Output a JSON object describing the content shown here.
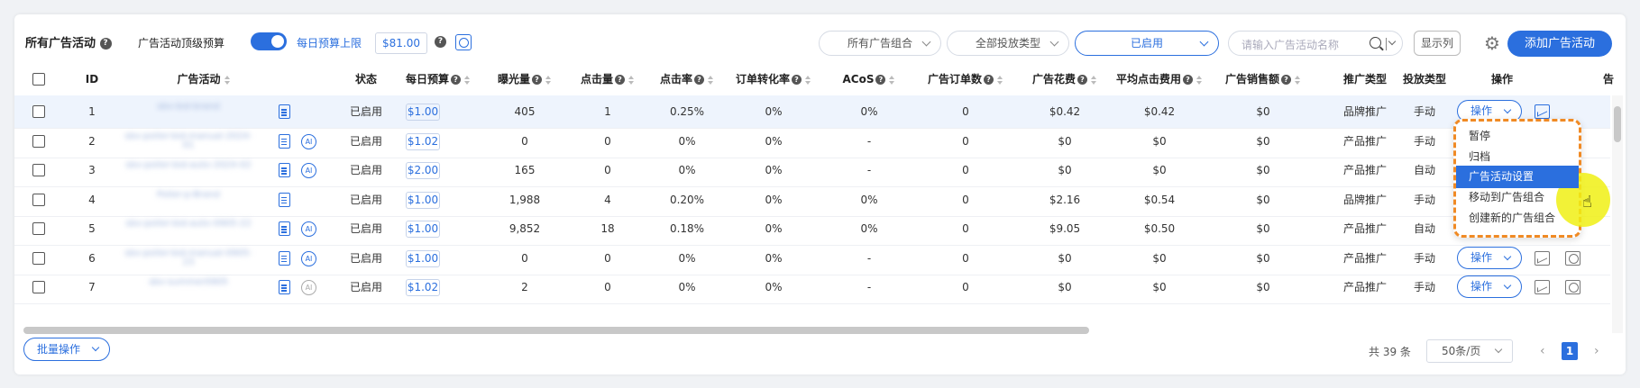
{
  "toolbar": {
    "title": "所有广告活动",
    "budget_label": "广告活动顶级预算",
    "daily_cap_label": "每日预算上限",
    "daily_cap_value": "$81.00",
    "filters": [
      "所有广告组合",
      "全部投放类型",
      "已启用"
    ],
    "search_placeholder": "请输入广告活动名称",
    "columns_button": "显示列",
    "add_button": "添加广告活动"
  },
  "table": {
    "headers": {
      "id": "ID",
      "campaign": "广告活动",
      "status": "状态",
      "daily_budget": "每日预算",
      "impressions": "曝光量",
      "clicks": "点击量",
      "ctr": "点击率",
      "cvr": "订单转化率",
      "acos": "ACoS",
      "orders": "广告订单数",
      "spend": "广告花费",
      "cpc": "平均点击费用",
      "sales": "广告销售额",
      "promo_type": "推广类型",
      "targeting": "投放类型",
      "actions": "操作",
      "extra": "告"
    },
    "rows": [
      {
        "id": "1",
        "name": "sbv-bid-brand",
        "status": "已启用",
        "budget": "$1.00",
        "impressions": "405",
        "clicks": "1",
        "ctr": "0.25%",
        "cvr": "0%",
        "acos": "0%",
        "orders": "0",
        "spend": "$0.42",
        "cpc": "$0.42",
        "sales": "$0",
        "promo": "品牌推广",
        "targeting": "手动",
        "ai": false,
        "ai_grey": false
      },
      {
        "id": "2",
        "name": "sbv-poller-bid-manual-2024-01",
        "status": "已启用",
        "budget": "$1.02",
        "impressions": "0",
        "clicks": "0",
        "ctr": "0%",
        "cvr": "0%",
        "acos": "-",
        "orders": "0",
        "spend": "$0",
        "cpc": "$0",
        "sales": "$0",
        "promo": "产品推广",
        "targeting": "手动",
        "ai": true,
        "ai_grey": false
      },
      {
        "id": "3",
        "name": "sbv-poller-bid-auto-2024-02",
        "status": "已启用",
        "budget": "$2.00",
        "impressions": "165",
        "clicks": "0",
        "ctr": "0%",
        "cvr": "0%",
        "acos": "-",
        "orders": "0",
        "spend": "$0",
        "cpc": "$0",
        "sales": "$0",
        "promo": "产品推广",
        "targeting": "自动",
        "ai": true,
        "ai_grey": false
      },
      {
        "id": "4",
        "name": "Poller-p-Brand",
        "status": "已启用",
        "budget": "$1.00",
        "impressions": "1,988",
        "clicks": "4",
        "ctr": "0.20%",
        "cvr": "0%",
        "acos": "0%",
        "orders": "0",
        "spend": "$2.16",
        "cpc": "$0.54",
        "sales": "$0",
        "promo": "品牌推广",
        "targeting": "手动",
        "ai": false,
        "ai_grey": false
      },
      {
        "id": "5",
        "name": "sbv-poller-bid-auto-0905-22",
        "status": "已启用",
        "budget": "$1.00",
        "impressions": "9,852",
        "clicks": "18",
        "ctr": "0.18%",
        "cvr": "0%",
        "acos": "0%",
        "orders": "0",
        "spend": "$9.05",
        "cpc": "$0.50",
        "sales": "$0",
        "promo": "产品推广",
        "targeting": "自动",
        "ai": true,
        "ai_grey": false
      },
      {
        "id": "6",
        "name": "sbv-poller-bid-manual-0905-23",
        "status": "已启用",
        "budget": "$1.00",
        "impressions": "0",
        "clicks": "0",
        "ctr": "0%",
        "cvr": "0%",
        "acos": "-",
        "orders": "0",
        "spend": "$0",
        "cpc": "$0",
        "sales": "$0",
        "promo": "产品推广",
        "targeting": "手动",
        "ai": true,
        "ai_grey": false
      },
      {
        "id": "7",
        "name": "sbv-summer0905",
        "status": "已启用",
        "budget": "$1.02",
        "impressions": "2",
        "clicks": "0",
        "ctr": "0%",
        "cvr": "0%",
        "acos": "-",
        "orders": "0",
        "spend": "$0",
        "cpc": "$0",
        "sales": "$0",
        "promo": "产品推广",
        "targeting": "手动",
        "ai": true,
        "ai_grey": true
      }
    ],
    "row_action_label": "操作"
  },
  "dropdown": {
    "items": [
      "暂停",
      "归档",
      "广告活动设置",
      "移动到广告组合",
      "创建新的广告组合"
    ],
    "active_index": 2
  },
  "footer": {
    "batch_label": "批量操作",
    "total": "共 39 条",
    "page_size": "50条/页",
    "current_page": "1"
  },
  "colors": {
    "accent": "#2b6fde",
    "highlight_border": "#f08a24",
    "cursor_highlight": "#f0f014"
  },
  "icons": [
    "help-icon",
    "clock-icon",
    "search-icon",
    "gear-icon",
    "doc-icon",
    "ai-icon",
    "chart-icon",
    "chevron-down-icon",
    "hand-cursor-icon"
  ]
}
